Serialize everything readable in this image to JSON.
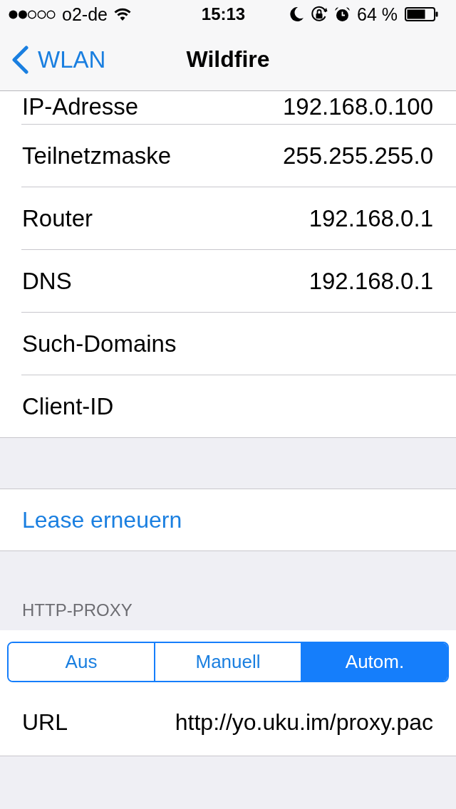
{
  "status_bar": {
    "carrier": "o2-de",
    "time": "15:13",
    "battery": "64 %"
  },
  "nav_bar": {
    "back": "WLAN",
    "title": "Wildfire"
  },
  "info_rows": [
    {
      "label": "IP-Adresse",
      "value": "192.168.0.100"
    },
    {
      "label": "Teilnetzmaske",
      "value": "255.255.255.0"
    },
    {
      "label": "Router",
      "value": "192.168.0.1"
    },
    {
      "label": "DNS",
      "value": "192.168.0.1"
    },
    {
      "label": "Such-Domains"
    },
    {
      "label": "Client-ID"
    }
  ],
  "lease_button": "Lease erneuern",
  "http_proxy": {
    "header": "HTTP-PROXY",
    "modes": [
      {
        "label": "Aus",
        "selected": false
      },
      {
        "label": "Manuell",
        "selected": false
      },
      {
        "label": "Autom.",
        "selected": true
      }
    ],
    "url": {
      "label": "URL",
      "value": "http://yo.uku.im/proxy.pac"
    }
  }
}
